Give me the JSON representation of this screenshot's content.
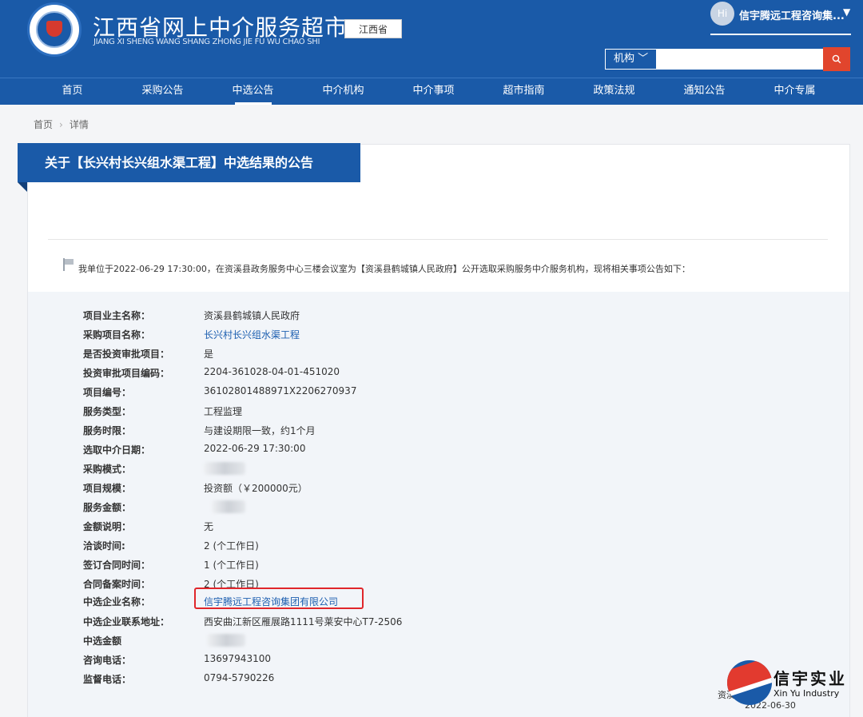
{
  "header": {
    "title": "江西省网上中介服务超市",
    "subtitle": "JIANG XI SHENG WANG SHANG ZHONG JIE FU WU CHAO SHI",
    "region": "江西省",
    "user": {
      "avatar": "Hi",
      "name": "信宇腾远工程咨询集...",
      "caret": "▼"
    },
    "search": {
      "type": "机构 ﹀",
      "placeholder": "",
      "button_icon": "search-icon"
    }
  },
  "nav": [
    "首页",
    "采购公告",
    "中选公告",
    "中介机构",
    "中介事项",
    "超市指南",
    "政策法规",
    "通知公告",
    "中介专属"
  ],
  "breadcrumb": {
    "home": "首页",
    "sep": "›",
    "current": "详情"
  },
  "notice": {
    "title": "关于【长兴村长兴组水渠工程】中选结果的公告",
    "intro": "我单位于2022-06-29 17:30:00，在资溪县政务服务中心三楼会议室为【资溪县鹤城镇人民政府】公开选取采购服务中介服务机构，现将相关事项公告如下："
  },
  "details": [
    {
      "label": "项目业主名称：",
      "value": "资溪县鹤城镇人民政府"
    },
    {
      "label": "采购项目名称：",
      "value": "长兴村长兴组水渠工程",
      "link": true
    },
    {
      "label": "是否投资审批项目：",
      "value": "是"
    },
    {
      "label": "投资审批项目编码：",
      "value": "2204-361028-04-01-451020"
    },
    {
      "label": "项目编号：",
      "value": "36102801488971X2206270937"
    },
    {
      "label": "服务类型：",
      "value": "工程监理"
    },
    {
      "label": "服务时限：",
      "value": "与建设期限一致，约1个月"
    },
    {
      "label": "选取中介日期：",
      "value": "2022-06-29 17:30:00"
    },
    {
      "label": "采购模式：",
      "value": "",
      "blurred": true
    },
    {
      "label": "项目规模：",
      "value": "投资额（￥200000元）"
    },
    {
      "label": "服务金额：",
      "value": "",
      "blurred": true
    },
    {
      "label": "金额说明：",
      "value": "无"
    },
    {
      "label": "洽谈时间:",
      "value": "2 (个工作日)"
    },
    {
      "label": "签订合同时间：",
      "value": "1 (个工作日)"
    },
    {
      "label": "合同备案时间：",
      "value": "2 (个工作日)"
    },
    {
      "label": "中选企业名称：",
      "value": "信宇腾远工程咨询集团有限公司",
      "link": true
    },
    {
      "label": "中选企业联系地址：",
      "value": "西安曲江新区雁展路1111号莱安中心T7-2506"
    },
    {
      "label": "中选金额",
      "value": "",
      "blurred": true
    },
    {
      "label": "咨询电话：",
      "value": "13697943100"
    },
    {
      "label": "监督电话：",
      "value": "0794-5790226"
    }
  ],
  "footer": {
    "dept": "资溪",
    "date": "2022-06-30"
  },
  "watermark": {
    "cn": "信宇实业",
    "en": "Xin Yu Industry"
  },
  "colors": {
    "brand": "#1a5aa8",
    "accent": "#e1452d",
    "link": "#1d5fb0",
    "highlight": "#e0262b"
  }
}
